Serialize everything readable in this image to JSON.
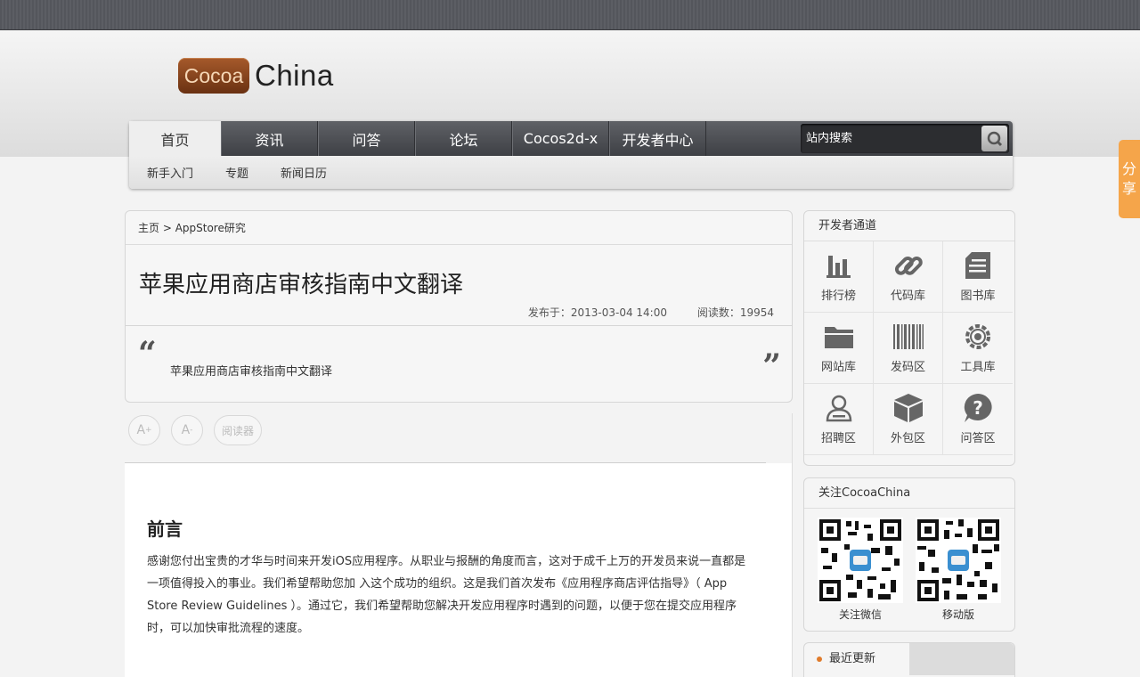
{
  "logo": {
    "badge": "Cocoa",
    "text": "China"
  },
  "nav": {
    "items": [
      "首页",
      "资讯",
      "问答",
      "论坛",
      "Cocos2d-x",
      "开发者中心"
    ],
    "sub_items": [
      "新手入门",
      "专题",
      "新闻日历"
    ],
    "search_placeholder": "站内搜索"
  },
  "share": {
    "label_1": "分",
    "label_2": "享"
  },
  "article": {
    "breadcrumb_home": "主页",
    "breadcrumb_sep": " > ",
    "breadcrumb_section": "AppStore研究",
    "title": "苹果应用商店审核指南中文翻译",
    "published": "发布于：2013-03-04 14:00",
    "views": "阅读数：19954",
    "quote_open": "“",
    "quote_close": "”",
    "summary": "苹果应用商店审核指南中文翻译",
    "tools": {
      "font_up": "A",
      "font_up_sup": "+",
      "font_down": "A",
      "font_down_sup": "-",
      "reader": "阅读器"
    },
    "heading": "前言",
    "paragraph": "感谢您付出宝贵的才华与时间来开发iOS应用程序。从职业与报酬的角度而言，这对于成千上万的开发员来说一直都是一项值得投入的事业。我们希望帮助您加 入这个成功的组织。这是我们首次发布《应用程序商店评估指导》（ App Store Review Guidelines ）。通过它，我们希望帮助您解决开发应用程序时遇到的问题，以便于您在提交应用程序时，可以加快审批流程的速度。"
  },
  "sidebar": {
    "dev_title": "开发者通道",
    "dev_items": [
      {
        "label": "排行榜",
        "icon": "bar-chart-icon"
      },
      {
        "label": "代码库",
        "icon": "link-icon"
      },
      {
        "label": "图书库",
        "icon": "document-icon"
      },
      {
        "label": "网站库",
        "icon": "folder-icon"
      },
      {
        "label": "发码区",
        "icon": "barcode-icon"
      },
      {
        "label": "工具库",
        "icon": "gear-icon"
      },
      {
        "label": "招聘区",
        "icon": "user-icon"
      },
      {
        "label": "外包区",
        "icon": "box-icon"
      },
      {
        "label": "问答区",
        "icon": "question-icon"
      }
    ],
    "follow_title": "关注CocoaChina",
    "qr_labels": [
      "关注微信",
      "移动版"
    ],
    "recent_tab": "最近更新"
  },
  "colors": {
    "nav_dark": "#3e4045",
    "share_orange": "#f5a54a",
    "logo_brown": "#8a4520",
    "accent_dot": "#e07b2b"
  }
}
